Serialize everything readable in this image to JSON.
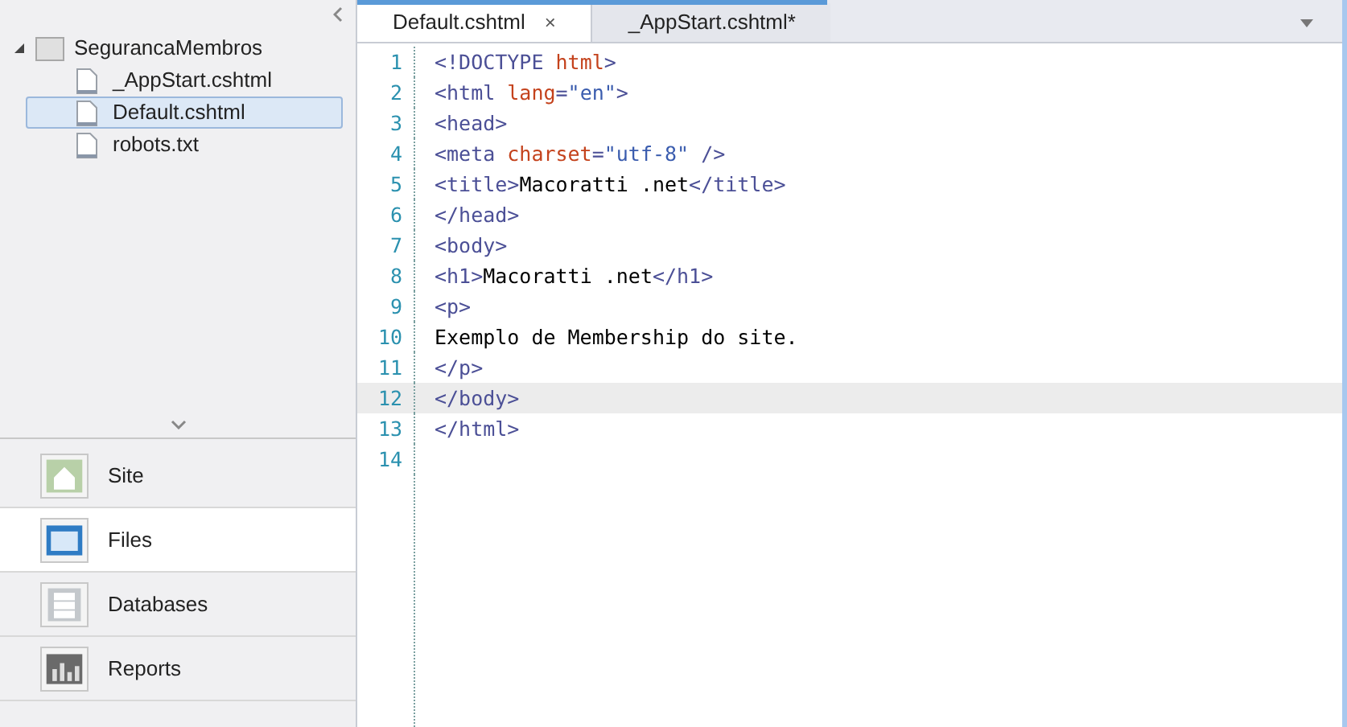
{
  "tree": {
    "label": "SegurancaMembros",
    "expanded": true,
    "children": [
      {
        "label": "_AppStart.cshtml",
        "selected": false
      },
      {
        "label": "Default.cshtml",
        "selected": true
      },
      {
        "label": "robots.txt",
        "selected": false
      }
    ]
  },
  "nav": [
    {
      "label": "Site",
      "kind": "site",
      "selected": false
    },
    {
      "label": "Files",
      "kind": "files",
      "selected": true
    },
    {
      "label": "Databases",
      "kind": "databases",
      "selected": false
    },
    {
      "label": "Reports",
      "kind": "reports",
      "selected": false
    }
  ],
  "tabs": [
    {
      "label": "Default.cshtml",
      "close": "×",
      "selected": true
    },
    {
      "label": "_AppStart.cshtml*",
      "selected": false
    }
  ],
  "lines": [
    {
      "number": "1",
      "current": false,
      "tokens": [
        {
          "kind": "tag",
          "text": "<!DOCTYPE "
        },
        {
          "kind": "attr",
          "text": "html"
        },
        {
          "kind": "tag",
          "text": ">"
        }
      ]
    },
    {
      "number": "2",
      "current": false,
      "tokens": [
        {
          "kind": "tag",
          "text": "<html "
        },
        {
          "kind": "attr",
          "text": "lang"
        },
        {
          "kind": "tag",
          "text": "="
        },
        {
          "kind": "value",
          "text": "\"en\""
        },
        {
          "kind": "tag",
          "text": ">"
        }
      ]
    },
    {
      "number": "3",
      "current": false,
      "tokens": [
        {
          "kind": "tag",
          "text": "<head>"
        }
      ]
    },
    {
      "number": "4",
      "current": false,
      "tokens": [
        {
          "kind": "tag",
          "text": "<meta "
        },
        {
          "kind": "attr",
          "text": "charset"
        },
        {
          "kind": "tag",
          "text": "="
        },
        {
          "kind": "value",
          "text": "\"utf-8\""
        },
        {
          "kind": "tag",
          "text": " />"
        }
      ]
    },
    {
      "number": "5",
      "current": false,
      "tokens": [
        {
          "kind": "tag",
          "text": "<title>"
        },
        {
          "kind": "text",
          "text": "Macoratti .net"
        },
        {
          "kind": "tag",
          "text": "</title>"
        }
      ]
    },
    {
      "number": "6",
      "current": false,
      "tokens": [
        {
          "kind": "tag",
          "text": "</head>"
        }
      ]
    },
    {
      "number": "7",
      "current": false,
      "tokens": [
        {
          "kind": "tag",
          "text": "<body>"
        }
      ]
    },
    {
      "number": "8",
      "current": false,
      "tokens": [
        {
          "kind": "tag",
          "text": "<h1>"
        },
        {
          "kind": "text",
          "text": "Macoratti .net"
        },
        {
          "kind": "tag",
          "text": "</h1>"
        }
      ]
    },
    {
      "number": "9",
      "current": false,
      "tokens": [
        {
          "kind": "tag",
          "text": "<p>"
        }
      ]
    },
    {
      "number": "10",
      "current": false,
      "tokens": [
        {
          "kind": "text",
          "text": "Exemplo de Membership do site."
        }
      ]
    },
    {
      "number": "11",
      "current": false,
      "tokens": [
        {
          "kind": "tag",
          "text": "</p>"
        }
      ]
    },
    {
      "number": "12",
      "current": true,
      "tokens": [
        {
          "kind": "tag",
          "text": "</body>"
        }
      ]
    },
    {
      "number": "13",
      "current": false,
      "tokens": [
        {
          "kind": "tag",
          "text": "</html>"
        }
      ]
    },
    {
      "number": "14",
      "current": false
    }
  ]
}
